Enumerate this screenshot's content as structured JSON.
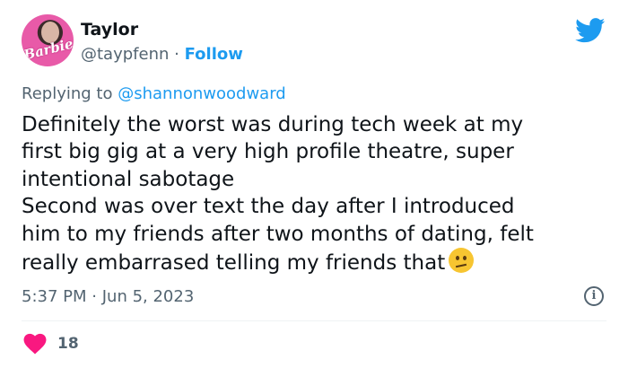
{
  "author": {
    "name": "Taylor",
    "handle": "@taypfenn",
    "separator": "·",
    "follow_label": "Follow",
    "avatar_brand": "Barbie"
  },
  "reply": {
    "prefix": "Replying to",
    "mention": "@shannonwoodward"
  },
  "tweet": {
    "lines": [
      "Definitely the worst was during tech week at my",
      "first big gig at a very high profile theatre, super",
      "intentional sabotage",
      "Second was over text the day after I introduced",
      "him to my friends after two months of dating, felt",
      "really embarrased telling my friends that"
    ],
    "emoji": "confused-face"
  },
  "meta": {
    "time": "5:37 PM",
    "separator": "·",
    "date": "Jun 5, 2023"
  },
  "engagement": {
    "likes": "18"
  },
  "colors": {
    "accent": "#1d9bf0",
    "text": "#0f1419",
    "muted": "#536471",
    "like": "#f91880"
  },
  "icons": {
    "brand": "twitter-bird-icon",
    "info": "info-icon",
    "like": "heart-icon"
  }
}
